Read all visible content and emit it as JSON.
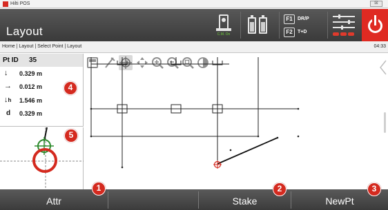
{
  "window": {
    "app_title": "Hilti POS",
    "close_glyph": "☒"
  },
  "header": {
    "page_title": "Layout",
    "instrument_sub": "C.M. On",
    "fkeys": [
      {
        "key": "F1",
        "label": "DR/P"
      },
      {
        "key": "F2",
        "label": "T+D"
      }
    ],
    "icons": [
      "instrument-icon",
      "battery-icon",
      "settings-icon",
      "power-icon"
    ],
    "power_color": "#df2a22"
  },
  "breadcrumb": {
    "path": "Home | Layout | Select Point | Layout",
    "time": "04:33"
  },
  "info": {
    "pt_label": "Pt ID",
    "pt_value": "35",
    "rows": [
      {
        "icon": "arrow-down-icon",
        "glyph": "↓",
        "suffix": "",
        "value": "0.329 m"
      },
      {
        "icon": "arrow-right-icon",
        "glyph": "→",
        "suffix": "",
        "value": "0.012 m"
      },
      {
        "icon": "height-down-icon",
        "glyph": "↓",
        "suffix": "h",
        "value": "1.546 m"
      },
      {
        "icon": "distance-icon",
        "glyph": "",
        "suffix": "d",
        "value": "0.329 m"
      }
    ]
  },
  "toolbar": {
    "tools": [
      "calculator-icon",
      "measure-tool-icon",
      "crosshair-icon",
      "pan-arrows-icon",
      "zoom-in-icon",
      "zoom-out-icon",
      "zoom-fit-icon",
      "contrast-icon"
    ],
    "selected": "crosshair-icon"
  },
  "softkeys": [
    {
      "label": "Attr"
    },
    {
      "label": ""
    },
    {
      "label": "Stake"
    },
    {
      "label": "NewPt"
    }
  ],
  "callouts": [
    "1",
    "2",
    "3",
    "4",
    "5"
  ],
  "colors": {
    "accent_red": "#d42a1f",
    "target_green": "#2e8b2e",
    "header_bg": "#4a4a4a"
  }
}
